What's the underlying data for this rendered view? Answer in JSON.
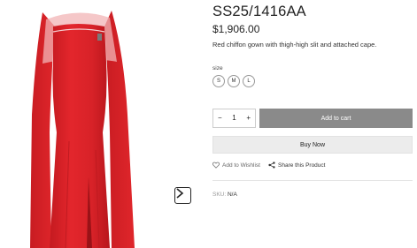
{
  "product": {
    "title": "SS25/1416AA",
    "price": "$1,906.00",
    "description": "Red chiffon gown with thigh-high slit and attached cape.",
    "image_alt": "Red chiffon gown with attached cape",
    "accent_color": "#e3262c"
  },
  "options": {
    "size_label": "size",
    "sizes": [
      "S",
      "M",
      "L"
    ]
  },
  "purchase": {
    "quantity": "1",
    "minus": "−",
    "plus": "+",
    "add_to_cart": "Add to cart",
    "buy_now": "Buy Now"
  },
  "actions": {
    "wishlist": "Add to Wishlist",
    "share": "Share this Product"
  },
  "meta": {
    "sku_label": "SKU:",
    "sku_value": "N/A"
  },
  "icons": {
    "next": "chevron-right-icon",
    "wishlist": "heart-icon",
    "share": "share-icon"
  }
}
